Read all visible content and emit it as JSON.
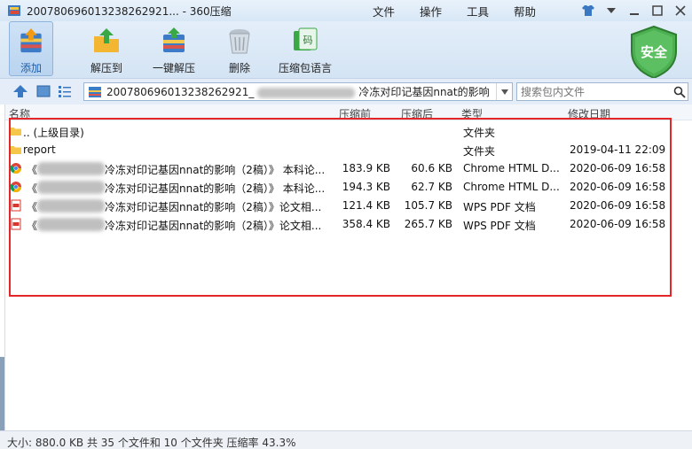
{
  "window": {
    "title": "2007806960132382​6292​1... - 360压缩",
    "menu": [
      "文件",
      "操作",
      "工具",
      "帮助"
    ]
  },
  "toolbar": {
    "buttons": [
      {
        "label": "添加",
        "icon": "add-archive-icon"
      },
      {
        "label": "解压到",
        "icon": "extract-to-icon"
      },
      {
        "label": "一键解压",
        "icon": "one-click-extract-icon"
      },
      {
        "label": "删除",
        "icon": "delete-trash-icon"
      },
      {
        "label": "压缩包语言",
        "icon": "archive-language-icon"
      }
    ],
    "security_label": "安全"
  },
  "address": {
    "path": "20078069601323826292​1_",
    "path_suffix": "冷冻对印记基因nnat的影响",
    "search_placeholder": "搜索包内文件"
  },
  "columns": {
    "name": "名称",
    "compressed_before": "压缩前",
    "compressed_after": "压缩后",
    "type": "类型",
    "modified": "修改日期"
  },
  "rows": [
    {
      "name": ".. (上级目录)",
      "size": "",
      "packed": "",
      "type": "文件夹",
      "date": "",
      "icon": "folder-icon"
    },
    {
      "name": "report",
      "size": "",
      "packed": "",
      "type": "文件夹",
      "date": "2019-04-11 22:09",
      "icon": "folder-icon"
    },
    {
      "name_prefix": "《",
      "name": "冷冻对印记基因nnat的影响（2稿）》 本科论...",
      "size": "183.9 KB",
      "packed": "60.6 KB",
      "type": "Chrome HTML D...",
      "date": "2020-06-09 16:58",
      "icon": "chrome-icon"
    },
    {
      "name_prefix": "《",
      "name": "冷冻对印记基因nnat的影响（2稿）》 本科论...",
      "size": "194.3 KB",
      "packed": "62.7 KB",
      "type": "Chrome HTML D...",
      "date": "2020-06-09 16:58",
      "icon": "chrome-icon"
    },
    {
      "name_prefix": "《",
      "name": "冷冻对印记基因nnat的影响（2稿）》论文相...",
      "size": "121.4 KB",
      "packed": "105.7 KB",
      "type": "WPS PDF 文档",
      "date": "2020-06-09 16:58",
      "icon": "pdf-icon"
    },
    {
      "name_prefix": "《",
      "name": "冷冻对印记基因nnat的影响（2稿）》论文相...",
      "size": "358.4 KB",
      "packed": "265.7 KB",
      "type": "WPS PDF 文档",
      "date": "2020-06-09 16:58",
      "icon": "pdf-icon"
    }
  ],
  "status": "大小: 880.0 KB 共 35 个文件和 10 个文件夹 压缩率 43.3%",
  "colors": {
    "accent": "#3a78c2",
    "highlight_box": "#e2262a",
    "shield": "#4caf50"
  }
}
